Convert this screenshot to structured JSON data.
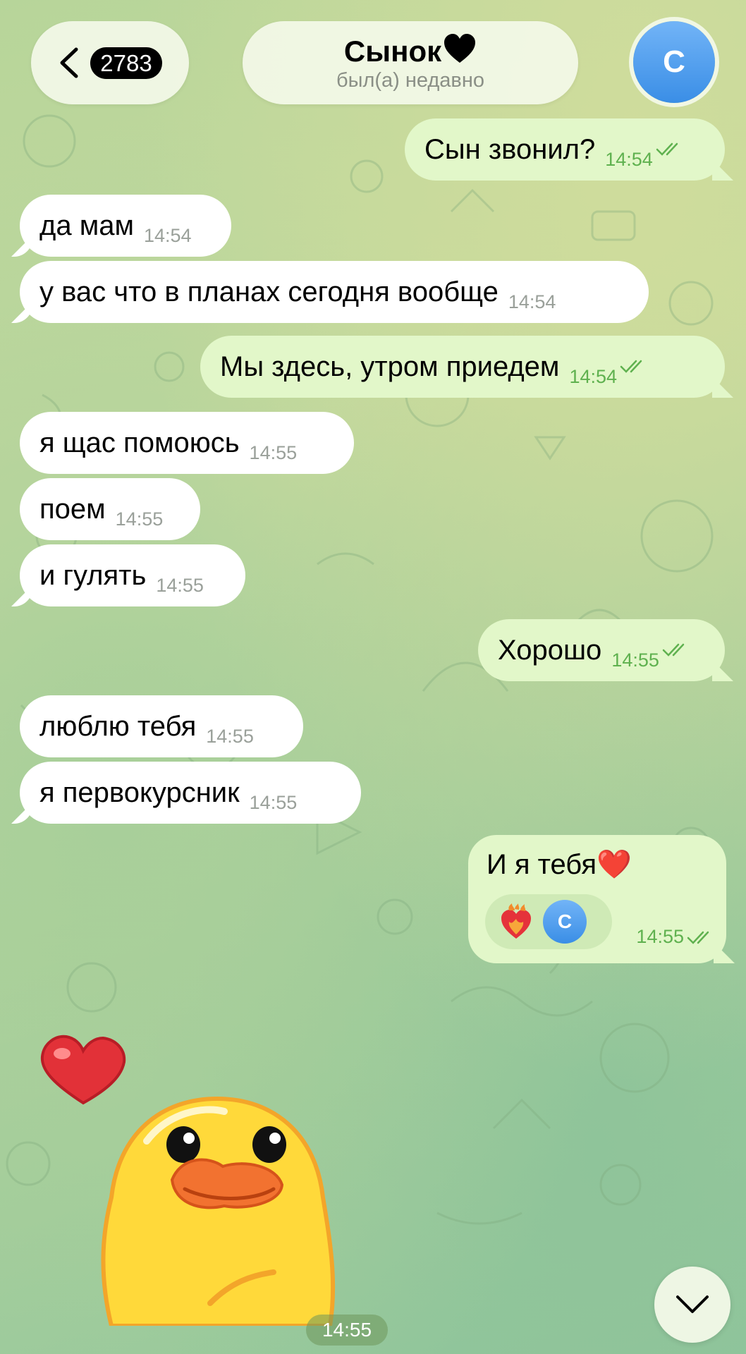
{
  "header": {
    "unread_count": "2783",
    "chat_name": "Сынок",
    "status": "был(а) недавно",
    "avatar_letter": "С"
  },
  "messages": [
    {
      "dir": "out",
      "text": "Сын звонил?",
      "time": "14:54",
      "read": true
    },
    {
      "dir": "in",
      "text": "да мам",
      "time": "14:54"
    },
    {
      "dir": "in",
      "text": "у вас что в планах сегодня вообще",
      "time": "14:54"
    },
    {
      "dir": "out",
      "text": "Мы здесь, утром приедем",
      "time": "14:54",
      "read": true
    },
    {
      "dir": "in",
      "text": "я щас помоюсь",
      "time": "14:55"
    },
    {
      "dir": "in",
      "text": "поем",
      "time": "14:55"
    },
    {
      "dir": "in",
      "text": "и гулять",
      "time": "14:55"
    },
    {
      "dir": "out",
      "text": "Хорошо",
      "time": "14:55",
      "read": true
    },
    {
      "dir": "in",
      "text": "люблю тебя",
      "time": "14:55"
    },
    {
      "dir": "in",
      "text": "я первокурсник",
      "time": "14:55"
    },
    {
      "dir": "out",
      "text": "И я тебя❤️",
      "time": "14:55",
      "read": true,
      "reaction": "heart-on-fire",
      "reaction_user": "С"
    }
  ],
  "sticker": {
    "name": "duck-with-heart",
    "time": "14:55"
  },
  "colors": {
    "incoming_bubble": "#ffffff",
    "outgoing_bubble": "#e2f7c9",
    "outgoing_time": "#5fb14f",
    "accent": "#3a8ee6"
  }
}
